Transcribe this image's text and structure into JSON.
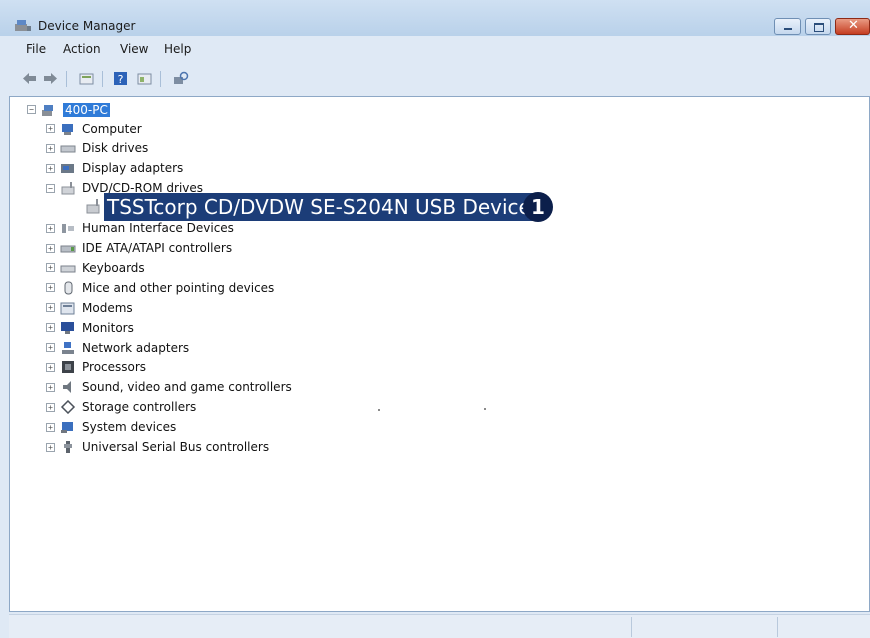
{
  "window": {
    "title": "Device Manager"
  },
  "menu": [
    {
      "label": "File"
    },
    {
      "label": "Action"
    },
    {
      "label": "View"
    },
    {
      "label": "Help"
    }
  ],
  "toolbar": {
    "icons": [
      "back-icon",
      "forward-icon",
      "properties-icon",
      "help-icon",
      "console-icon",
      "scan-hardware-icon"
    ]
  },
  "tree": {
    "root": "400-PC",
    "categories": [
      {
        "label": "Computer",
        "icon": "computer-icon"
      },
      {
        "label": "Disk drives",
        "icon": "disk-drive-icon"
      },
      {
        "label": "Display adapters",
        "icon": "display-adapter-icon"
      },
      {
        "label": "DVD/CD-ROM drives",
        "icon": "dvd-drive-icon"
      },
      {
        "label": "Human Interface Devices",
        "icon": "hid-icon"
      },
      {
        "label": "IDE ATA/ATAPI controllers",
        "icon": "ide-controller-icon"
      },
      {
        "label": "Keyboards",
        "icon": "keyboard-icon"
      },
      {
        "label": "Mice and other pointing devices",
        "icon": "mouse-icon"
      },
      {
        "label": "Modems",
        "icon": "modem-icon"
      },
      {
        "label": "Monitors",
        "icon": "monitor-icon"
      },
      {
        "label": "Network adapters",
        "icon": "network-adapter-icon"
      },
      {
        "label": "Processors",
        "icon": "processor-icon"
      },
      {
        "label": "Sound, video and game controllers",
        "icon": "speaker-icon"
      },
      {
        "label": "Storage controllers",
        "icon": "storage-controller-icon"
      },
      {
        "label": "System devices",
        "icon": "system-devices-icon"
      },
      {
        "label": "Universal Serial Bus controllers",
        "icon": "usb-icon"
      }
    ],
    "selected_device": "TSSTcorp CD/DVDW SE-S204N USB Device",
    "callout_number": "1"
  },
  "colors": {
    "selection": "#1c3d78",
    "root_highlight": "#2f7bd8",
    "callout": "#0c1f4b"
  }
}
